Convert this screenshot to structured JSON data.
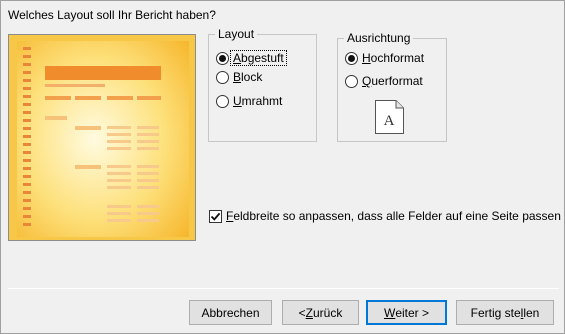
{
  "wizard": {
    "question": "Welches Layout soll Ihr Bericht haben?"
  },
  "layout": {
    "legend": "Layout",
    "options": [
      {
        "pre": "",
        "key": "A",
        "post": "bgestuft",
        "selected": true
      },
      {
        "pre": "",
        "key": "B",
        "post": "lock",
        "selected": false
      },
      {
        "pre": "",
        "key": "U",
        "post": "mrahmt",
        "selected": false
      }
    ]
  },
  "orientation": {
    "legend": "Ausrichtung",
    "options": [
      {
        "pre": "",
        "key": "H",
        "post": "ochformat",
        "selected": true
      },
      {
        "pre": "",
        "key": "Q",
        "post": "uerformat",
        "selected": false
      }
    ],
    "page_icon_letter": "A"
  },
  "fit_fields": {
    "pre": "",
    "key": "F",
    "post": "eldbreite so anpassen, dass alle Felder auf eine Seite passen",
    "checked": true
  },
  "buttons": {
    "cancel": {
      "pre": "Abbrechen",
      "key": "",
      "post": ""
    },
    "back": {
      "pre": "< ",
      "key": "Z",
      "post": "urück"
    },
    "next": {
      "pre": "",
      "key": "W",
      "post": "eiter >"
    },
    "finish": {
      "pre": "Fertig ste",
      "key": "l",
      "post": "len"
    }
  },
  "colors": {
    "preview_bg": "#fde58a",
    "preview_accent": "#f08c2c"
  }
}
